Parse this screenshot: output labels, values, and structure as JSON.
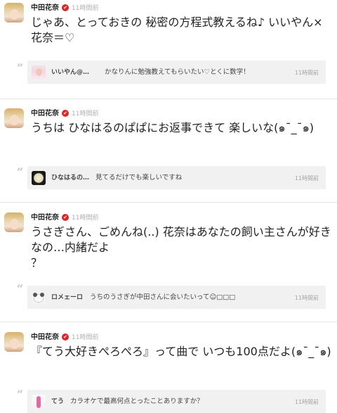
{
  "posts": [
    {
      "author": "中田花奈",
      "verified": "✔",
      "time": "11時間前",
      "body": "じゃあ、とっておきの 秘密の方程式教えるね♪ いいやん×花奈＝♡",
      "reply": {
        "author": "いいやん@…",
        "text": "かなりんに勉強教えてもらいたい♡とくに数学！",
        "time": "11時間前"
      }
    },
    {
      "author": "中田花奈",
      "verified": "✔",
      "time": "11時間前",
      "body": "うちは ひなはるのぱぱにお返事できて 楽しいな(๑¯_¯๑)",
      "reply": {
        "author": "ひなはるの…",
        "text": "見てるだけでも楽しいですね",
        "time": "11時間前"
      }
    },
    {
      "author": "中田花奈",
      "verified": "✔",
      "time": "11時間前",
      "body": "うさぎさん、ごめんね(..) 花奈はあなたの飼い主さんが好きなの…内緒だよ\n？",
      "reply": {
        "author": "ロメェーロ",
        "text": "うちのうさぎが中田さんに会いたいって☺□□□",
        "time": "11時間前"
      }
    },
    {
      "author": "中田花奈",
      "verified": "✔",
      "time": "11時間前",
      "body": "『てう大好きぺろぺろ』って曲で いつも100点だよ(๑¯_¯๑)",
      "reply": {
        "author": "てう",
        "text": "カラオケで最高何点とったことありますか？",
        "time": "11時間前"
      }
    }
  ]
}
